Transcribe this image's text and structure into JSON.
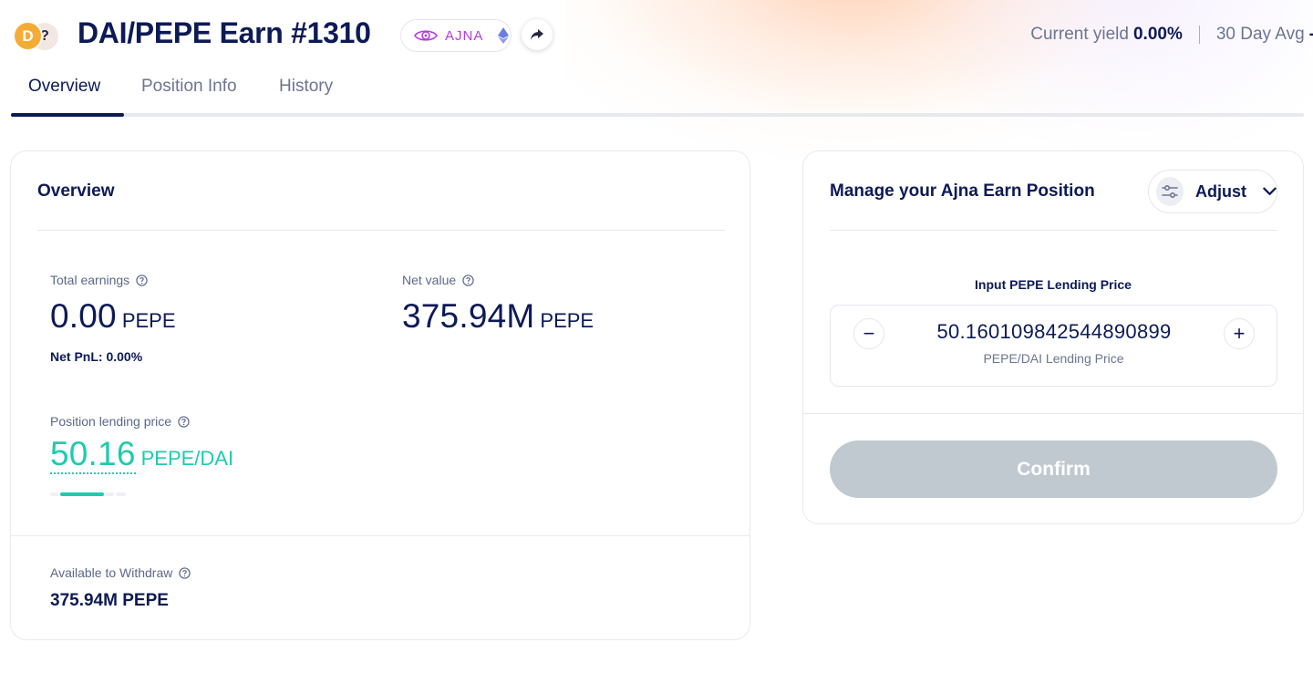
{
  "header": {
    "title": "DAI/PEPE Earn #1310",
    "token_a_symbol": "D",
    "token_b_symbol": "?",
    "protocol": "AJNA",
    "network_icon": "ethereum-icon",
    "share_icon": "share-arrow-icon",
    "current_yield_label": "Current yield",
    "current_yield_value": "0.00%",
    "avg_label": "30 Day Avg",
    "avg_value": "-"
  },
  "tabs": [
    {
      "label": "Overview",
      "active": true
    },
    {
      "label": "Position Info",
      "active": false
    },
    {
      "label": "History",
      "active": false
    }
  ],
  "overview": {
    "title": "Overview",
    "total_earnings": {
      "label": "Total earnings",
      "value": "0.00",
      "unit": "PEPE"
    },
    "net_pnl": "Net PnL: 0.00%",
    "net_value": {
      "label": "Net value",
      "value": "375.94M",
      "unit": "PEPE"
    },
    "lending_price": {
      "label": "Position lending price",
      "value": "50.16",
      "unit": "PEPE/DAI"
    },
    "available_withdraw": {
      "label": "Available to Withdraw",
      "value": "375.94M PEPE"
    }
  },
  "manage": {
    "title": "Manage your Ajna Earn Position",
    "adjust_label": "Adjust",
    "input_label": "Input PEPE Lending Price",
    "price_value": "50.160109842544890899",
    "price_sub": "PEPE/DAI Lending Price",
    "minus_label": "−",
    "plus_label": "+",
    "confirm_label": "Confirm"
  },
  "colors": {
    "primary": "#0c1a56",
    "accent_teal": "#1ecbae",
    "ajna_purple": "#b23ce0",
    "dai_orange": "#f5ac37",
    "button_disabled": "#c0c9d0"
  }
}
